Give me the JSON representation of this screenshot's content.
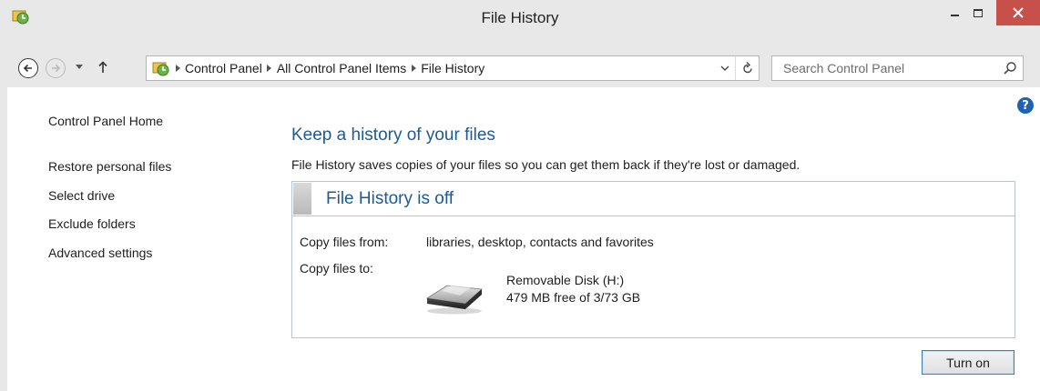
{
  "window": {
    "title": "File History"
  },
  "nav": {
    "breadcrumbs": [
      "Control Panel",
      "All Control Panel Items",
      "File History"
    ],
    "search_placeholder": "Search Control Panel"
  },
  "sidebar": {
    "home": "Control Panel Home",
    "items": [
      "Restore personal files",
      "Select drive",
      "Exclude folders",
      "Advanced settings"
    ]
  },
  "main": {
    "title": "Keep a history of your files",
    "description": "File History saves copies of your files so you can get them back if they're lost or damaged.",
    "status": "File History is off",
    "copy_from_label": "Copy files from:",
    "copy_from_value": "libraries, desktop, contacts and favorites",
    "copy_to_label": "Copy files to:",
    "drive_name": "Removable Disk (H:)",
    "drive_free": "479 MB free of 3/73 GB",
    "turn_on_label": "Turn on"
  },
  "colors": {
    "accent_title": "#1e5a96",
    "close_button": "#c7504b",
    "help": "#1f62b5"
  }
}
